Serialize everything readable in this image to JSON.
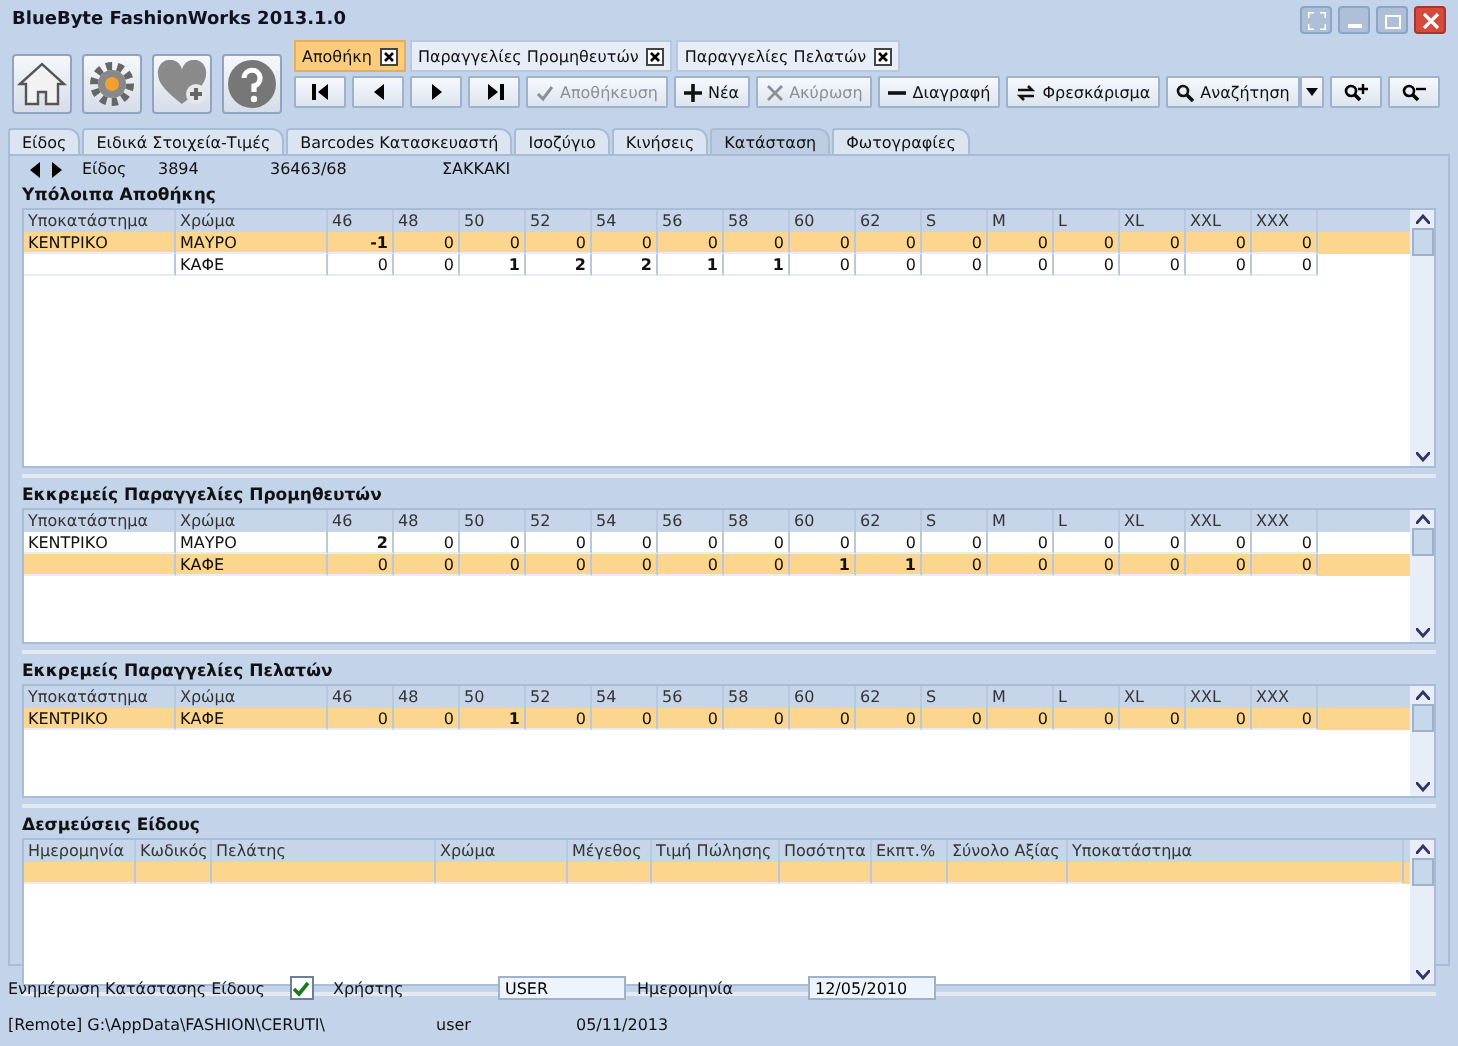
{
  "window": {
    "title": "BlueByte FashionWorks 2013.1.0"
  },
  "doc_tabs": [
    {
      "label": "Αποθήκη",
      "selected": true
    },
    {
      "label": "Παραγγελίες Προμηθευτών",
      "selected": false
    },
    {
      "label": "Παραγγελίες Πελατών",
      "selected": false
    }
  ],
  "actions": [
    {
      "label": "Αποθήκευση",
      "kind": "save",
      "disabled": true
    },
    {
      "label": "Νέα",
      "kind": "new",
      "disabled": false
    },
    {
      "label": "Ακύρωση",
      "kind": "cancel",
      "disabled": true
    },
    {
      "label": "Διαγραφή",
      "kind": "delete",
      "disabled": false
    },
    {
      "label": "Φρεσκάρισμα",
      "kind": "refresh",
      "disabled": false
    },
    {
      "label": "Αναζήτηση",
      "kind": "search",
      "disabled": false
    }
  ],
  "tabs": [
    {
      "label": "Είδος",
      "selected": false
    },
    {
      "label": "Ειδικά Στοιχεία-Τιμές",
      "selected": false
    },
    {
      "label": "Barcodes Κατασκευαστή",
      "selected": false
    },
    {
      "label": "Ισοζύγιο",
      "selected": false
    },
    {
      "label": "Κινήσεις",
      "selected": false
    },
    {
      "label": "Κατάσταση",
      "selected": true
    },
    {
      "label": "Φωτογραφίες",
      "selected": false
    }
  ],
  "item": {
    "label": "Είδος",
    "id": "3894",
    "code": "36463/68",
    "name": "ΣΑΚΚΑΚΙ"
  },
  "grids": [
    {
      "kind": "sizes",
      "title": "Υπόλοιπα Αποθήκης",
      "columns": [
        "Υποκατάστημα",
        "Χρώμα",
        "46",
        "48",
        "50",
        "52",
        "54",
        "56",
        "58",
        "60",
        "62",
        "S",
        "M",
        "L",
        "XL",
        "XXL",
        "XXX"
      ],
      "rows": [
        {
          "selected": true,
          "cells": [
            "ΚΕΝΤΡΙΚΟ",
            "ΜΑΥΡΟ",
            "-1",
            "0",
            "0",
            "0",
            "0",
            "0",
            "0",
            "0",
            "0",
            "0",
            "0",
            "0",
            "0",
            "0",
            "0"
          ]
        },
        {
          "selected": false,
          "cells": [
            "",
            "ΚΑΦΕ",
            "0",
            "0",
            "1",
            "2",
            "2",
            "1",
            "1",
            "0",
            "0",
            "0",
            "0",
            "0",
            "0",
            "0",
            "0"
          ]
        }
      ]
    },
    {
      "kind": "sizes",
      "title": "Εκκρεμείς Παραγγελίες Προμηθευτών",
      "columns": [
        "Υποκατάστημα",
        "Χρώμα",
        "46",
        "48",
        "50",
        "52",
        "54",
        "56",
        "58",
        "60",
        "62",
        "S",
        "M",
        "L",
        "XL",
        "XXL",
        "XXX"
      ],
      "rows": [
        {
          "selected": false,
          "cells": [
            "ΚΕΝΤΡΙΚΟ",
            "ΜΑΥΡΟ",
            "2",
            "0",
            "0",
            "0",
            "0",
            "0",
            "0",
            "0",
            "0",
            "0",
            "0",
            "0",
            "0",
            "0",
            "0"
          ]
        },
        {
          "selected": true,
          "cells": [
            "",
            "ΚΑΦΕ",
            "0",
            "0",
            "0",
            "0",
            "0",
            "0",
            "0",
            "1",
            "1",
            "0",
            "0",
            "0",
            "0",
            "0",
            "0"
          ]
        }
      ]
    },
    {
      "kind": "sizes",
      "title": "Εκκρεμείς Παραγγελίες Πελατών",
      "columns": [
        "Υποκατάστημα",
        "Χρώμα",
        "46",
        "48",
        "50",
        "52",
        "54",
        "56",
        "58",
        "60",
        "62",
        "S",
        "M",
        "L",
        "XL",
        "XXL",
        "XXX"
      ],
      "rows": [
        {
          "selected": true,
          "cells": [
            "ΚΕΝΤΡΙΚΟ",
            "ΚΑΦΕ",
            "0",
            "0",
            "1",
            "0",
            "0",
            "0",
            "0",
            "0",
            "0",
            "0",
            "0",
            "0",
            "0",
            "0",
            "0"
          ]
        }
      ]
    },
    {
      "kind": "reservations",
      "title": "Δεσμεύσεις Είδους",
      "columns": [
        "Ημερομηνία",
        "Κωδικός",
        "Πελάτης",
        "Χρώμα",
        "Μέγεθος",
        "Τιμή Πώλησης",
        "Ποσότητα",
        "Εκπτ.%",
        "Σύνολο Αξίας",
        "Υποκατάστημα"
      ],
      "rows": [
        {
          "selected": true,
          "cells": []
        }
      ]
    }
  ],
  "footer": {
    "update_label": "Ενημέρωση Κατάστασης Είδους",
    "update_checked": true,
    "user_label": "Χρήστης",
    "user": "USER",
    "date_label": "Ημερομηνία",
    "date": "12/05/2010"
  },
  "status_bar": {
    "path": "[Remote] G:\\AppData\\FASHION\\CERUTI\\",
    "user": "user",
    "date": "05/11/2013"
  }
}
